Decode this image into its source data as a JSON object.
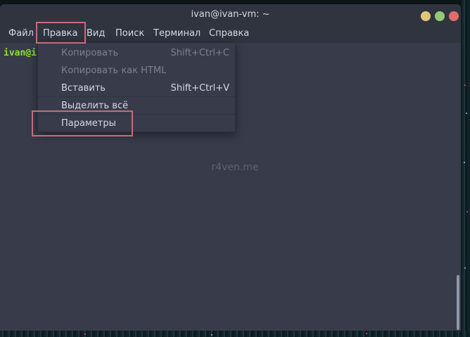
{
  "window": {
    "title": "ivan@ivan-vm: ~",
    "controls": {
      "minimize_icon": "circle-yellow",
      "maximize_icon": "circle-green",
      "close_icon": "circle-red"
    }
  },
  "menubar": {
    "items": [
      "Файл",
      "Правка",
      "Вид",
      "Поиск",
      "Терминал",
      "Справка"
    ],
    "active": "Правка"
  },
  "edit_menu": {
    "items": [
      {
        "label": "Копировать",
        "shortcut": "Shift+Ctrl+C",
        "enabled": false
      },
      {
        "label": "Копировать как HTML",
        "shortcut": "",
        "enabled": false
      },
      {
        "label": "Вставить",
        "shortcut": "Shift+Ctrl+V",
        "enabled": true
      },
      {
        "label": "Выделить всё",
        "shortcut": "",
        "enabled": true
      },
      {
        "label": "Параметры",
        "shortcut": "",
        "enabled": true
      }
    ]
  },
  "terminal": {
    "prompt_visible": "ivan@i"
  },
  "watermark": "r4ven.me",
  "colors": {
    "accent": "#5294e2",
    "highlight_frame": "#c86b78",
    "prompt_green": "#8ae234",
    "window_bg": "#383c4a",
    "titlebar_bg": "#2f343f"
  }
}
